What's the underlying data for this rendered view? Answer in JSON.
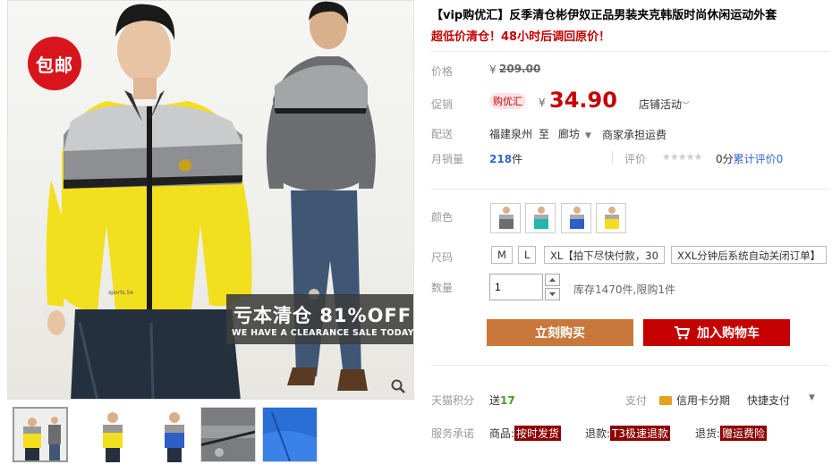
{
  "gallery": {
    "badge": "包邮",
    "sale_title": "亏本清仓 81%OFF",
    "sale_subtitle": "WE HAVE A CLEARANCE SALE TODAY",
    "chest_text": "sports.5e"
  },
  "product": {
    "title": "【vip购优汇】反季清仓彬伊奴正品男装夹克韩版时尚休闲运动外套",
    "subtitle": "超低价清仓！48小时后调回原价！"
  },
  "price": {
    "label": "价格",
    "currency": "¥",
    "original": "209.00"
  },
  "promo": {
    "label": "促销",
    "tag": "购优汇",
    "currency": "¥",
    "price": "34.90",
    "shop_activity": "店铺活动"
  },
  "shipping": {
    "label": "配送",
    "from": "福建泉州",
    "to_word": "至",
    "dest": "廊坊",
    "note": "商家承担运费"
  },
  "sales": {
    "label": "月销量",
    "count": "218",
    "unit": "件",
    "rating_label": "评价",
    "score": "0分",
    "reviews_text": "累计评价",
    "reviews_count": "0"
  },
  "color": {
    "label": "颜色",
    "swatches": [
      "grey",
      "teal",
      "blue",
      "yellow"
    ]
  },
  "size": {
    "label": "尺码",
    "options": [
      "M",
      "L",
      "XL【拍下尽快付款，30",
      "XXL分钟后系统自动关闭订单】"
    ]
  },
  "quantity": {
    "label": "数量",
    "value": "1",
    "stock_text": "库存1470件,限购1件"
  },
  "actions": {
    "buy_now": "立刻购买",
    "add_to_cart": "加入购物车"
  },
  "points": {
    "label": "天猫积分",
    "send": "送",
    "amount": "17",
    "pay_label": "支付",
    "credit_card": "信用卡分期",
    "quick_pay": "快捷支付"
  },
  "service": {
    "label": "服务承诺",
    "goods_label": "商品:",
    "goods_badge": "按时发货",
    "refund_label": "退款:",
    "refund_badge": "T3极速退款",
    "return_label": "退货:",
    "return_badge": "赠运费险"
  },
  "colors": {
    "price_red": "#c40000",
    "buy_orange": "#c8783a",
    "link_blue": "#3366cc",
    "badge_red": "#d8151c",
    "promise_bg": "#8c0000"
  }
}
